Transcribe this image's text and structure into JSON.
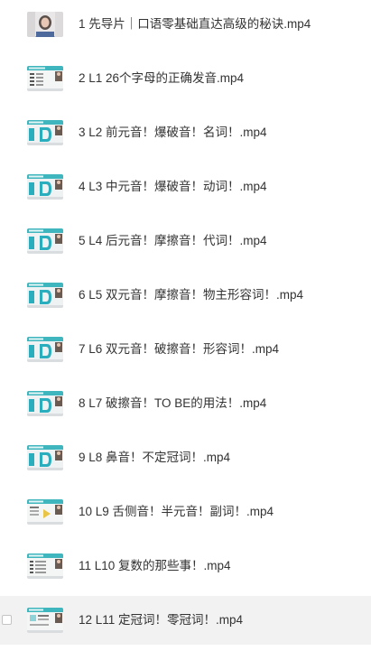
{
  "files": [
    {
      "name": "1 先导片｜口语零基础直达高级的秘诀.mp4",
      "thumbnail": "intro-video-thumbnail",
      "selected": false
    },
    {
      "name": "2 L1 26个字母的正确发音.mp4",
      "thumbnail": "lesson-slide-thumbnail",
      "selected": false
    },
    {
      "name": "3 L2 前元音！爆破音！名词！.mp4",
      "thumbnail": "lesson-slide-thumbnail",
      "selected": false
    },
    {
      "name": "4 L3 中元音！爆破音！动词！.mp4",
      "thumbnail": "lesson-slide-thumbnail",
      "selected": false
    },
    {
      "name": "5 L4 后元音！摩擦音！代词！.mp4",
      "thumbnail": "lesson-slide-thumbnail",
      "selected": false
    },
    {
      "name": "6 L5 双元音！摩擦音！物主形容词！.mp4",
      "thumbnail": "lesson-slide-thumbnail",
      "selected": false
    },
    {
      "name": "7 L6 双元音！破擦音！形容词！.mp4",
      "thumbnail": "lesson-slide-thumbnail",
      "selected": false
    },
    {
      "name": "8 L7 破擦音！TO BE的用法！.mp4",
      "thumbnail": "lesson-slide-thumbnail",
      "selected": false
    },
    {
      "name": "9 L8 鼻音！不定冠词！.mp4",
      "thumbnail": "lesson-slide-thumbnail",
      "selected": false
    },
    {
      "name": "10 L9 舌侧音！半元音！副词！.mp4",
      "thumbnail": "lesson-slide-thumbnail",
      "selected": false
    },
    {
      "name": "11 L10 复数的那些事！.mp4",
      "thumbnail": "lesson-slide-thumbnail",
      "selected": false
    },
    {
      "name": "12 L11 定冠词！零冠词！.mp4",
      "thumbnail": "lesson-slide-thumbnail",
      "selected": false,
      "hovered": true
    }
  ],
  "colors": {
    "text": "#333333",
    "hover_background": "#f2f2f2",
    "thumbnail_header": "#3fb6bd",
    "thumbnail_accent": "#2aaebd",
    "checkbox_border": "#c4c4c4"
  }
}
